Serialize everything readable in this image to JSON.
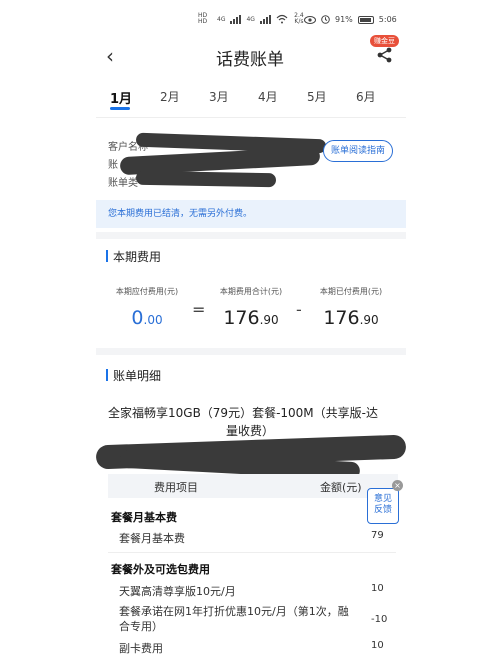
{
  "status_bar": {
    "hd1": "HD",
    "hd2": "HD",
    "net1": "4G",
    "net2": "4G",
    "speed": "2.4 K/s",
    "battery": "91%",
    "time": "5:06"
  },
  "header": {
    "title": "话费账单",
    "badge": "赚金豆"
  },
  "month_tabs": [
    {
      "label": "1月",
      "active": true
    },
    {
      "label": "2月",
      "active": false
    },
    {
      "label": "3月",
      "active": false
    },
    {
      "label": "4月",
      "active": false
    },
    {
      "label": "5月",
      "active": false
    },
    {
      "label": "6月",
      "active": false
    }
  ],
  "customer": {
    "line1": "客户名称",
    "line2": "账",
    "line3": "账单类",
    "guide_button": "账单阅读指南"
  },
  "notice": "您本期费用已结清，无需另外付费。",
  "current_fee": {
    "section_title": "本期费用",
    "payable_label": "本期应付费用(元)",
    "payable_int": "0",
    "payable_dec": ".00",
    "op1": "=",
    "total_label": "本期费用合计(元)",
    "total_int": "176",
    "total_dec": ".90",
    "op2": "-",
    "paid_label": "本期已付费用(元)",
    "paid_int": "176",
    "paid_dec": ".90"
  },
  "bill_detail": {
    "section_title": "账单明细",
    "package_line1": "全家福畅享10GB（79元）套餐-100M（共享版-达",
    "package_line2": "量收费）",
    "col_item": "费用项目",
    "col_amount": "金额(元)",
    "group1": "套餐月基本费",
    "rows1": [
      {
        "name": "套餐月基本费",
        "amount": "79"
      }
    ],
    "group2": "套餐外及可选包费用",
    "rows2": [
      {
        "name": "天翼高清尊享版10元/月",
        "amount": "10"
      },
      {
        "name": "套餐承诺在网1年打折优惠10元/月（第1次，融",
        "name2": "合专用）",
        "amount": "-10"
      },
      {
        "name": "副卡费用",
        "amount": "10"
      }
    ]
  },
  "feedback": {
    "line1": "意见",
    "line2": "反馈",
    "close": "×"
  }
}
